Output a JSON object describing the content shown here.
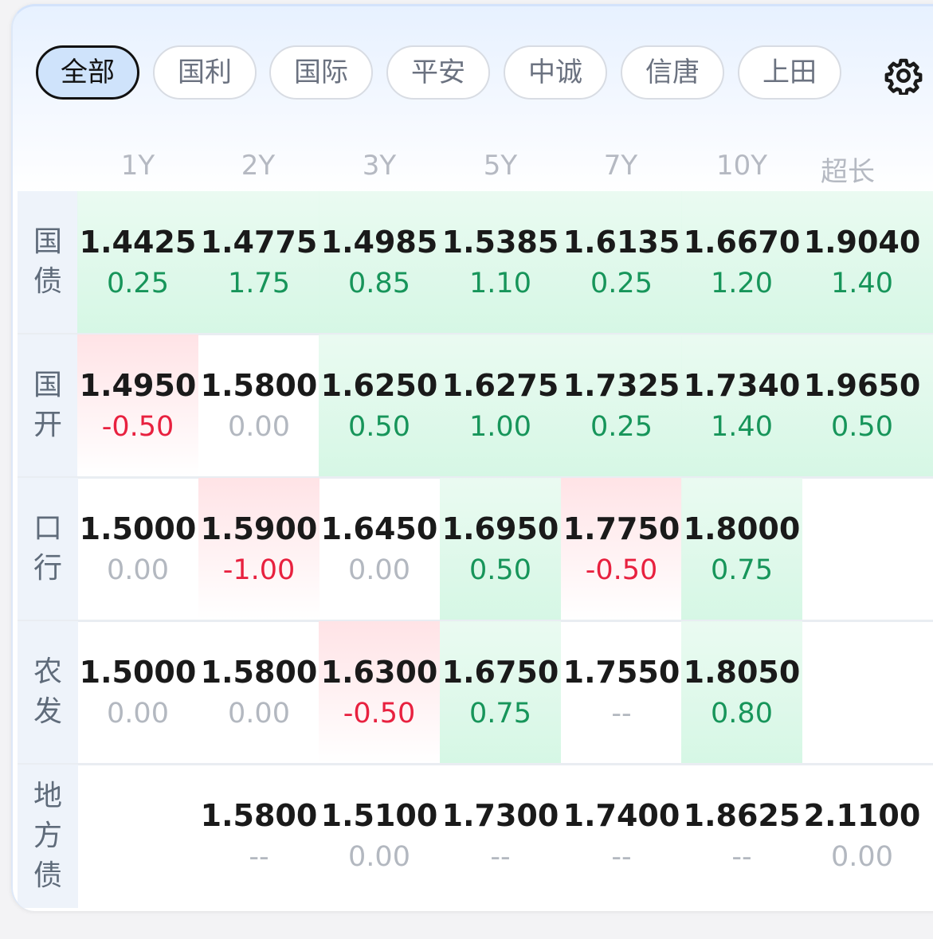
{
  "tabs": [
    "全部",
    "国利",
    "国际",
    "平安",
    "中诚",
    "信唐",
    "上田"
  ],
  "active_tab": 0,
  "columns": [
    "1Y",
    "2Y",
    "3Y",
    "5Y",
    "7Y",
    "10Y",
    "超长"
  ],
  "rows": [
    {
      "label": [
        "国",
        "债"
      ],
      "cells": [
        {
          "yield": "1.4425",
          "change": "0.25",
          "dir": "up"
        },
        {
          "yield": "1.4775",
          "change": "1.75",
          "dir": "up"
        },
        {
          "yield": "1.4985",
          "change": "0.85",
          "dir": "up"
        },
        {
          "yield": "1.5385",
          "change": "1.10",
          "dir": "up"
        },
        {
          "yield": "1.6135",
          "change": "0.25",
          "dir": "up"
        },
        {
          "yield": "1.6670",
          "change": "1.20",
          "dir": "up"
        },
        {
          "yield": "1.9040",
          "change": "1.40",
          "dir": "up"
        }
      ]
    },
    {
      "label": [
        "国",
        "开"
      ],
      "cells": [
        {
          "yield": "1.4950",
          "change": "-0.50",
          "dir": "down"
        },
        {
          "yield": "1.5800",
          "change": "0.00",
          "dir": "flat"
        },
        {
          "yield": "1.6250",
          "change": "0.50",
          "dir": "up"
        },
        {
          "yield": "1.6275",
          "change": "1.00",
          "dir": "up"
        },
        {
          "yield": "1.7325",
          "change": "0.25",
          "dir": "up"
        },
        {
          "yield": "1.7340",
          "change": "1.40",
          "dir": "up"
        },
        {
          "yield": "1.9650",
          "change": "0.50",
          "dir": "up"
        }
      ]
    },
    {
      "label": [
        "口",
        "行"
      ],
      "cells": [
        {
          "yield": "1.5000",
          "change": "0.00",
          "dir": "flat"
        },
        {
          "yield": "1.5900",
          "change": "-1.00",
          "dir": "down"
        },
        {
          "yield": "1.6450",
          "change": "0.00",
          "dir": "flat"
        },
        {
          "yield": "1.6950",
          "change": "0.50",
          "dir": "up"
        },
        {
          "yield": "1.7750",
          "change": "-0.50",
          "dir": "down"
        },
        {
          "yield": "1.8000",
          "change": "0.75",
          "dir": "up"
        },
        {
          "yield": "",
          "change": "",
          "dir": "none"
        }
      ]
    },
    {
      "label": [
        "农",
        "发"
      ],
      "cells": [
        {
          "yield": "1.5000",
          "change": "0.00",
          "dir": "flat"
        },
        {
          "yield": "1.5800",
          "change": "0.00",
          "dir": "flat"
        },
        {
          "yield": "1.6300",
          "change": "-0.50",
          "dir": "down"
        },
        {
          "yield": "1.6750",
          "change": "0.75",
          "dir": "up"
        },
        {
          "yield": "1.7550",
          "change": "--",
          "dir": "flat"
        },
        {
          "yield": "1.8050",
          "change": "0.80",
          "dir": "up"
        },
        {
          "yield": "",
          "change": "",
          "dir": "none"
        }
      ]
    },
    {
      "label": [
        "地",
        "方",
        "债"
      ],
      "cells": [
        {
          "yield": "",
          "change": "",
          "dir": "none"
        },
        {
          "yield": "1.5800",
          "change": "--",
          "dir": "flat"
        },
        {
          "yield": "1.5100",
          "change": "0.00",
          "dir": "flat"
        },
        {
          "yield": "1.7300",
          "change": "--",
          "dir": "flat"
        },
        {
          "yield": "1.7400",
          "change": "--",
          "dir": "flat"
        },
        {
          "yield": "1.8625",
          "change": "--",
          "dir": "flat"
        },
        {
          "yield": "2.1100",
          "change": "0.00",
          "dir": "flat"
        }
      ]
    }
  ],
  "colors": {
    "up": "#17955a",
    "down": "#e8213f",
    "flat": "#b3b8c0",
    "accent": "#cfe3fb"
  },
  "icons": {
    "settings": "gear-icon"
  }
}
